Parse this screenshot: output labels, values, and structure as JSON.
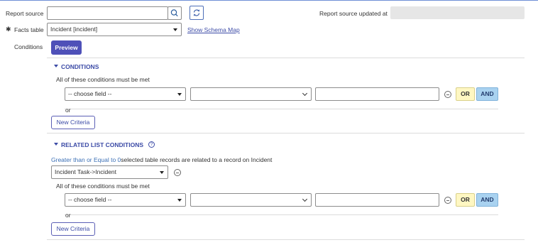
{
  "header": {
    "report_source_label": "Report source",
    "report_source_value": "",
    "report_source_updated_label": "Report source updated at",
    "report_source_updated_value": "",
    "facts_table_label": "Facts table",
    "required_marker": "✱",
    "facts_table_value": "Incident [incident]",
    "show_schema_map": "Show Schema Map",
    "conditions_label": "Conditions",
    "preview_button": "Preview"
  },
  "conditions": {
    "section_title": "CONDITIONS",
    "requirement_text": "All of these conditions must be met",
    "field_select": "-- choose field --",
    "operator_select": "",
    "value_input": "",
    "or_button": "OR",
    "and_button": "AND",
    "or_label": "or",
    "new_criteria_button": "New Criteria"
  },
  "related_list": {
    "section_title": "RELATED LIST CONDITIONS",
    "help_icon_glyph": "?",
    "quantifier_link": "Greater than or Equal to 0",
    "description": "selected table records are related to a record on Incident",
    "relation_select": "Incident Task->Incident",
    "requirement_text": "All of these conditions must be met",
    "field_select": "-- choose field --",
    "operator_select": "",
    "value_input": "",
    "or_button": "OR",
    "and_button": "AND",
    "or_label": "or",
    "new_criteria_button": "New Criteria"
  },
  "icons": [
    "search-icon",
    "refresh-icon",
    "dropdown-caret-icon",
    "chevron-down-icon",
    "remove-condition-icon",
    "help-icon",
    "collapse-triangle-icon",
    "required-asterisk-icon"
  ],
  "colors": {
    "primary": "#4e50b8",
    "link": "#3b4aa6",
    "or_bg": "#fff7c2",
    "and_bg": "#a9d2f0"
  }
}
